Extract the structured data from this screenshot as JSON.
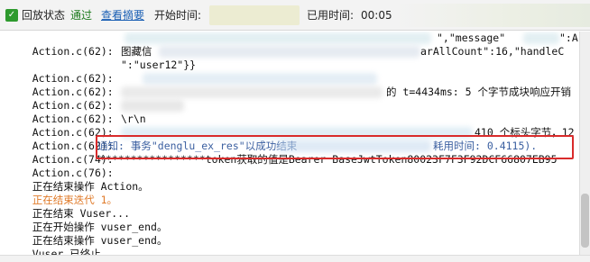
{
  "status_bar": {
    "status_label": "回放状态",
    "status_result": "通过",
    "view_summary_link": "查看摘要",
    "start_time_label": "开始时间:",
    "elapsed_label": "已用时间:",
    "elapsed_value": "00:05"
  },
  "log": {
    "prefixes": [
      "Action.c(62):",
      "Action.c(62):",
      "Action.c(62):",
      "Action.c(62):",
      "Action.c(62):",
      "Action.c(62):",
      "Action.c(62):",
      "Action.c(74):",
      "Action.c(76):"
    ],
    "fragments": {
      "message_key": "\",\"message\"",
      "message_tail": "\":A",
      "line2_mid": "图藏信",
      "line2_right": "arAllCount\":16,\"handleC",
      "line3": "\":\"user12\"}}",
      "line5_mid": "的 t=4434ms: 5 个字节成块响应开销",
      "line7": "\\r\\n",
      "line8_right": "410 个标头字节，12",
      "line9_left": "通知: 事务\"denglu_ex_res\"以成功结束",
      "line9_right": "耗用时间: 0.4115)."
    },
    "token_line": "*****************token获取的值是Bearer BaseJwtToken80023F7F3F92DCF66807EB95",
    "lines": [
      "正在结束操作 Action。",
      "正在结束迭代 1。",
      "正在结束 Vuser...",
      "正在开始操作 vuser_end。",
      "正在结束操作 vuser_end。",
      "Vuser 已终止。"
    ]
  },
  "colors": {
    "pass_green": "#1d7a1d",
    "link_blue": "#1a5fb4",
    "iteration_orange": "#e07b2a",
    "highlight_red": "#d92b2b"
  }
}
